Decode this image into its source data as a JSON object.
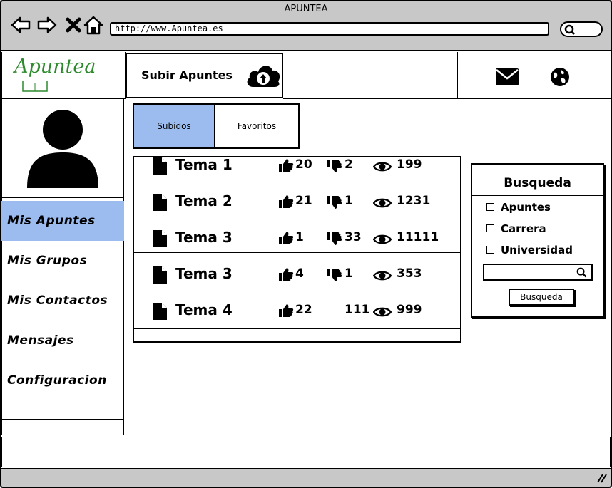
{
  "window": {
    "title": "APUNTEA"
  },
  "browser": {
    "url": "http://www.Apuntea.es",
    "nav_icons": [
      "back-arrow-icon",
      "forward-arrow-icon",
      "close-x-icon",
      "home-icon"
    ]
  },
  "header": {
    "logo": "Apuntea",
    "upload_label": "Subir Apuntes",
    "icons": [
      "cloud-upload-icon",
      "mail-icon",
      "globe-icon"
    ]
  },
  "sidebar": {
    "items": [
      {
        "label": "Mis Apuntes",
        "active": true
      },
      {
        "label": "Mis Grupos",
        "active": false
      },
      {
        "label": "Mis Contactos",
        "active": false
      },
      {
        "label": "Mensajes",
        "active": false
      },
      {
        "label": "Configuracion",
        "active": false
      }
    ]
  },
  "tabs": [
    {
      "label": "Subidos",
      "active": true
    },
    {
      "label": "Favoritos",
      "active": false
    }
  ],
  "notes": [
    {
      "title": "Tema 1",
      "likes": "20",
      "dislikes": "2",
      "views": "199"
    },
    {
      "title": "Tema 2",
      "likes": "21",
      "dislikes": "1",
      "views": "1231"
    },
    {
      "title": "Tema 3",
      "likes": "1",
      "dislikes": "33",
      "views": "11111"
    },
    {
      "title": "Tema 3",
      "likes": "4",
      "dislikes": "1",
      "views": "353"
    },
    {
      "title": "Tema 4",
      "likes": "22",
      "dislikes": "111",
      "views": "999"
    }
  ],
  "search_panel": {
    "title": "Busqueda",
    "filters": [
      "Apuntes",
      "Carrera",
      "Universidad"
    ],
    "input_value": "",
    "button_label": "Busqueda"
  },
  "colors": {
    "accent": "#9cbcef",
    "chrome": "#c8c8c8",
    "logo": "#2d8a2d"
  }
}
